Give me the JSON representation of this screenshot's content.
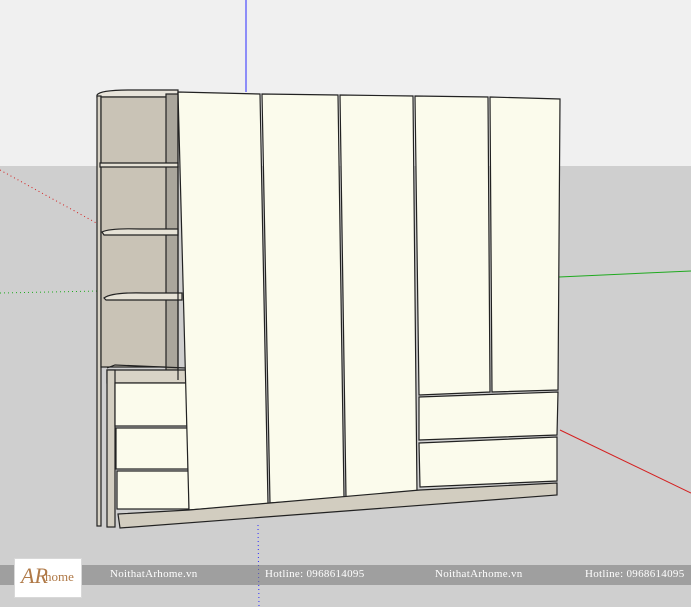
{
  "colors": {
    "sky": "#f0f0f0",
    "ground": "#cfcfcf",
    "door_face": "#fbfbec",
    "wood": "#c9c3b6",
    "edge": "#222222",
    "axis_blue": "#2a2aff",
    "axis_green": "#1faa1f",
    "axis_red": "#d42020",
    "logo_brown": "#b07a48"
  },
  "icons": [
    "ar-home-logo"
  ],
  "watermark": {
    "logo_ar": "AR",
    "logo_home": "home",
    "items": [
      "NoithatArhome.vn",
      "Hotline: 0968614095",
      "NoithatArhome.vn",
      "Hotline: 0968614095"
    ]
  }
}
